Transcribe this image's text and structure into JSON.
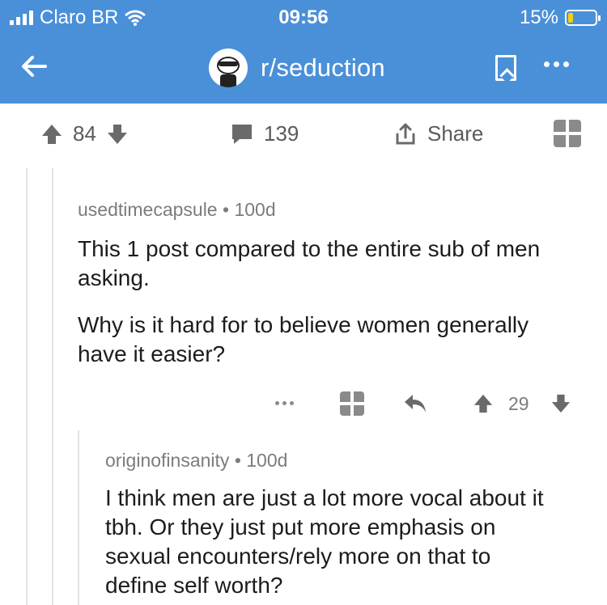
{
  "status_bar": {
    "carrier": "Claro BR",
    "time": "09:56",
    "battery": "15%"
  },
  "header": {
    "subreddit": "r/seduction"
  },
  "post_actions": {
    "upvotes": "84",
    "comments": "139",
    "share_label": "Share"
  },
  "comments": [
    {
      "author": "usedtimecapsule",
      "age": "100d",
      "paragraphs": [
        "This 1 post compared to the entire sub of men asking.",
        "Why is it hard for to believe women generally have it easier?"
      ],
      "votes": "29"
    },
    {
      "author": "originofinsanity",
      "age": "100d",
      "paragraphs": [
        "I think men are just a lot more vocal about it tbh. Or they just put more emphasis on sexual encounters/rely more on that to define self worth?"
      ]
    }
  ],
  "colors": {
    "header_bg": "#4a90d9",
    "icon_gray": "#8a8a8a",
    "text": "#1c1c1c",
    "meta": "#7c7c7c"
  },
  "icons": [
    "signal-icon",
    "wifi-icon",
    "battery-icon",
    "back-arrow-icon",
    "bookmark-icon",
    "more-icon",
    "upvote-icon",
    "downvote-icon",
    "comment-icon",
    "share-icon",
    "gift-icon",
    "reply-icon"
  ]
}
